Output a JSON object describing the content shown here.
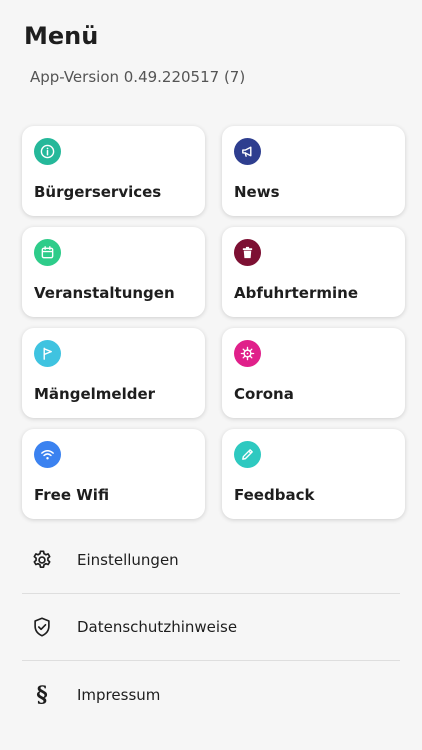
{
  "header": {
    "title": "Menü",
    "version": "App-Version 0.49.220517 (7)"
  },
  "tiles": [
    {
      "label": "Bürgerservices",
      "icon": "info-icon",
      "color": "#25b89a"
    },
    {
      "label": "News",
      "icon": "megaphone-icon",
      "color": "#2e3e8f"
    },
    {
      "label": "Veranstaltungen",
      "icon": "calendar-icon",
      "color": "#2ecc8a"
    },
    {
      "label": "Abfuhrtermine",
      "icon": "trash-icon",
      "color": "#7d1033"
    },
    {
      "label": "Mängelmelder",
      "icon": "flag-icon",
      "color": "#3fc3e0"
    },
    {
      "label": "Corona",
      "icon": "virus-icon",
      "color": "#e0208a"
    },
    {
      "label": "Free Wifi",
      "icon": "wifi-icon",
      "color": "#3b82f0"
    },
    {
      "label": "Feedback",
      "icon": "pencil-icon",
      "color": "#2ec9c0"
    }
  ],
  "list": [
    {
      "label": "Einstellungen",
      "icon": "gear-icon"
    },
    {
      "label": "Datenschutzhinweise",
      "icon": "shield-check-icon"
    },
    {
      "label": "Impressum",
      "icon": "section-sign-icon",
      "glyph": "§"
    }
  ]
}
